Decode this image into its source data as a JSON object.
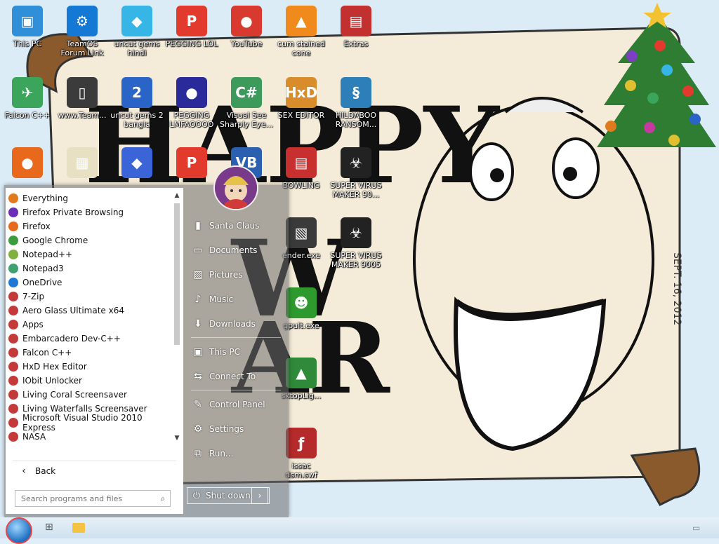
{
  "desktop": {
    "icons": [
      {
        "label": "This PC",
        "color": "#2f8fd8",
        "glyph": "▣",
        "name": "this-pc-icon"
      },
      {
        "label": "TeamOS\nForum Link",
        "color": "#1479d4",
        "glyph": "⚙",
        "name": "gear-icon"
      },
      {
        "label": "uncut gems\nhindi",
        "color": "#35b6e6",
        "glyph": "◆",
        "name": "gem-icon"
      },
      {
        "label": "PEGGING LOL",
        "color": "#e23b2e",
        "glyph": "P",
        "name": "pegging-icon"
      },
      {
        "label": "YouTube",
        "color": "#d93a2f",
        "glyph": "●",
        "name": "angry-bird-icon"
      },
      {
        "label": "cum stained\ncone",
        "color": "#f08a1c",
        "glyph": "▲",
        "name": "vlc-cone-icon"
      },
      {
        "label": "Extras",
        "color": "#c23030",
        "glyph": "▤",
        "name": "folder-icon"
      },
      {
        "label": "Falcon C++",
        "color": "#3ca55c",
        "glyph": "✈",
        "name": "falcon-icon"
      },
      {
        "label": "www.Team...",
        "color": "#3b3b3b",
        "glyph": "▯",
        "name": "file-icon"
      },
      {
        "label": "uncut gems 2\nbangla",
        "color": "#2a64c6",
        "glyph": "2",
        "name": "gem-icon"
      },
      {
        "label": "PEGGING\nLMFAOOOO",
        "color": "#2a2a9a",
        "glyph": "●",
        "name": "pegging-icon"
      },
      {
        "label": "Visual See\nSharply Eye...",
        "color": "#3c9b5a",
        "glyph": "C#",
        "name": "visual-studio-icon"
      },
      {
        "label": "SEX EDITOR",
        "color": "#d98c2c",
        "glyph": "HxD",
        "name": "hex-editor-icon"
      },
      {
        "label": "HILDABOO\nRANSOM...",
        "color": "#2c7fb8",
        "glyph": "§",
        "name": "script-icon"
      },
      {
        "label": "",
        "color": "#e8681c",
        "glyph": "●",
        "name": "firefox-icon"
      },
      {
        "label": "",
        "color": "#e7e0c2",
        "glyph": "▦",
        "name": "pixel-icon"
      },
      {
        "label": "",
        "color": "#3b64d8",
        "glyph": "◆",
        "name": "gem-icon"
      },
      {
        "label": "",
        "color": "#e23b2e",
        "glyph": "P",
        "name": "pegging-icon"
      },
      {
        "label": "",
        "color": "#2b5fb0",
        "glyph": "VB",
        "name": "visual-basic-icon"
      },
      {
        "label": "BOWLING",
        "color": "#c83030",
        "glyph": "▤",
        "name": "folder-icon"
      },
      {
        "label": "SUPER VIRUS\nMAKER 90...",
        "color": "#222",
        "glyph": "☣",
        "name": "virus-maker-icon"
      },
      {
        "label": "ender.exe",
        "color": "#3a3a3a",
        "glyph": "▧",
        "name": "program-icon"
      },
      {
        "label": "SUPER VIRUS\nMAKER 9005",
        "color": "#222",
        "glyph": "☣",
        "name": "virus-maker-icon"
      },
      {
        "label": "gpult.exe",
        "color": "#2e9a2e",
        "glyph": "☻",
        "name": "program-icon"
      },
      {
        "label": "sktopLig...",
        "color": "#2f8a3a",
        "glyph": "▲",
        "name": "tree-icon"
      },
      {
        "label": "issac\ndsm.swf",
        "color": "#b52a2a",
        "glyph": "ƒ",
        "name": "flash-file-icon"
      }
    ]
  },
  "start_menu": {
    "programs": [
      {
        "label": "Everything",
        "color": "#e07a1c"
      },
      {
        "label": "Firefox Private Browsing",
        "color": "#6a2bb8"
      },
      {
        "label": "Firefox",
        "color": "#e8681c"
      },
      {
        "label": "Google Chrome",
        "color": "#3c9b3c"
      },
      {
        "label": "Notepad++",
        "color": "#7fb040"
      },
      {
        "label": "Notepad3",
        "color": "#3fa070"
      },
      {
        "label": "OneDrive",
        "color": "#1e78d4"
      },
      {
        "label": "7-Zip",
        "color": "#c43a3a"
      },
      {
        "label": "Aero Glass Ultimate x64",
        "color": "#c43a3a"
      },
      {
        "label": "Apps",
        "color": "#c43a3a"
      },
      {
        "label": "Embarcadero Dev-C++",
        "color": "#c43a3a"
      },
      {
        "label": "Falcon C++",
        "color": "#c43a3a"
      },
      {
        "label": "HxD Hex Editor",
        "color": "#c43a3a"
      },
      {
        "label": "IObit Unlocker",
        "color": "#c43a3a"
      },
      {
        "label": "Living Coral Screensaver",
        "color": "#c43a3a"
      },
      {
        "label": "Living Waterfalls Screensaver",
        "color": "#c43a3a"
      },
      {
        "label": "Microsoft Visual Studio 2010 Express",
        "color": "#c43a3a"
      },
      {
        "label": "NASA",
        "color": "#c43a3a"
      }
    ],
    "back_label": "Back",
    "search_placeholder": "Search programs and files",
    "right_items": [
      {
        "label": "Santa Claus",
        "icon": "▮",
        "name": "user-folder-icon"
      },
      {
        "label": "Documents",
        "icon": "▭",
        "name": "documents-icon"
      },
      {
        "label": "Pictures",
        "icon": "▨",
        "name": "pictures-icon"
      },
      {
        "label": "Music",
        "icon": "♪",
        "name": "music-icon"
      },
      {
        "label": "Downloads",
        "icon": "⬇",
        "name": "downloads-icon"
      },
      {
        "label": "This PC",
        "icon": "▣",
        "name": "this-pc-icon"
      },
      {
        "label": "Connect To",
        "icon": "⇆",
        "name": "connect-icon"
      },
      {
        "label": "Control Panel",
        "icon": "✎",
        "name": "control-panel-icon"
      },
      {
        "label": "Settings",
        "icon": "⚙",
        "name": "settings-icon"
      },
      {
        "label": "Run...",
        "icon": "⧉",
        "name": "run-icon"
      }
    ],
    "shutdown_label": "Shut down"
  }
}
